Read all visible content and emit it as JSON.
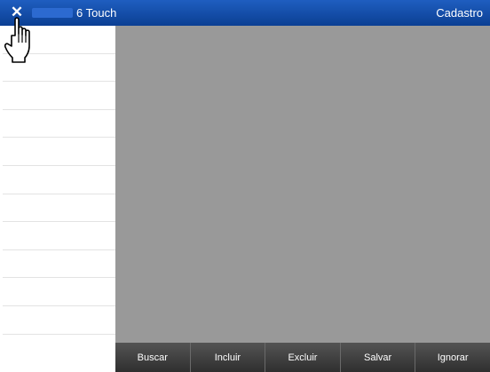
{
  "titlebar": {
    "close_glyph": "✕",
    "app_title": "6 Touch",
    "screen_title": "Cadastro",
    "color": "#0b3f93"
  },
  "sidebar": {
    "row_count": 12
  },
  "content": {
    "background": "#999999"
  },
  "toolbar": {
    "buttons": [
      {
        "label": "Buscar"
      },
      {
        "label": "Incluir"
      },
      {
        "label": "Excluir"
      },
      {
        "label": "Salvar"
      },
      {
        "label": "Ignorar"
      }
    ]
  },
  "cursor": {
    "icon": "hand-pointer-icon"
  }
}
